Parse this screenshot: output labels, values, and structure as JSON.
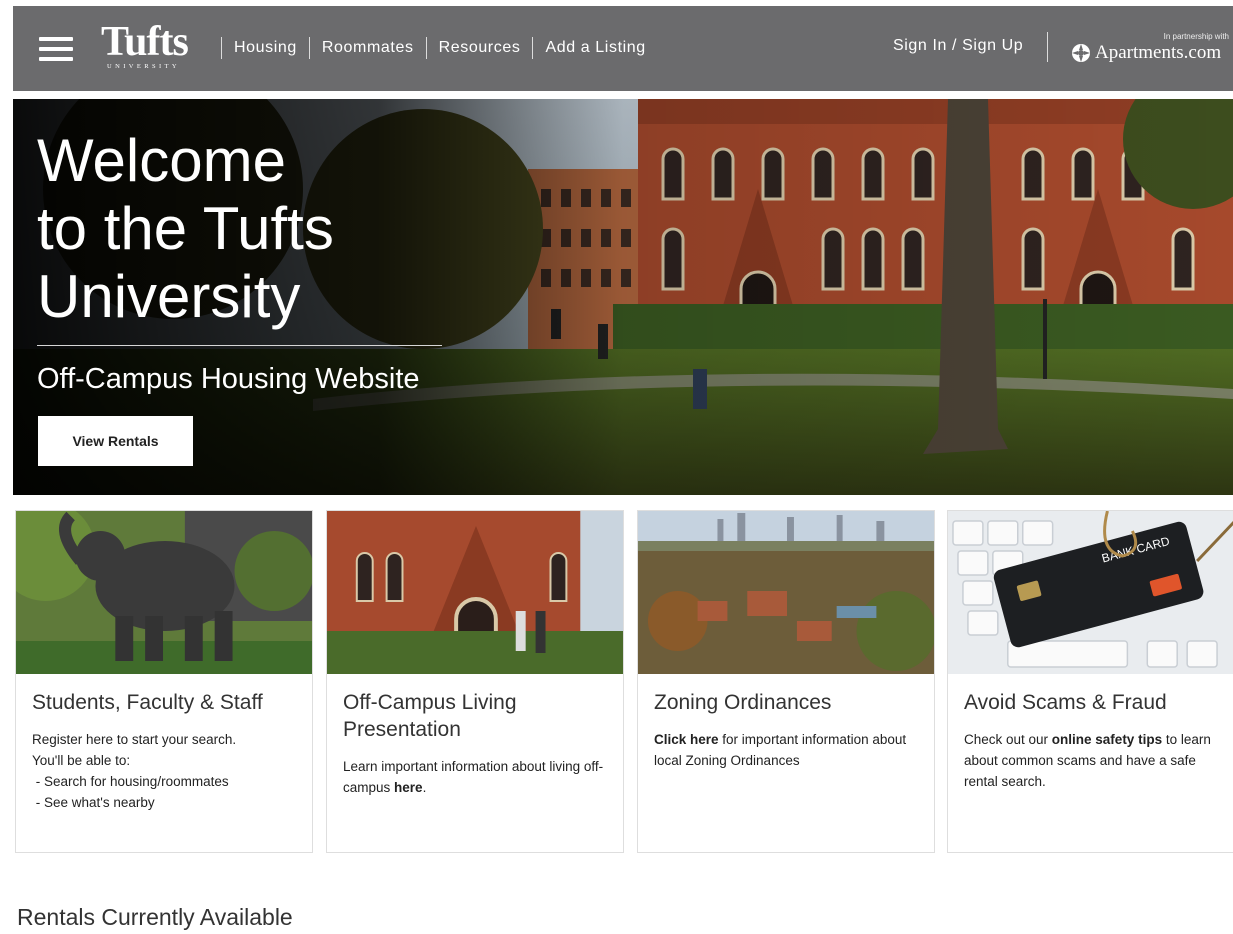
{
  "nav": {
    "logo_text": "Tufts",
    "logo_sub": "UNIVERSITY",
    "links": [
      "Housing",
      "Roommates",
      "Resources",
      "Add a Listing"
    ],
    "signin": "Sign In / Sign Up",
    "partner_note": "In partnership with",
    "partner_name": "Apartments.com"
  },
  "hero": {
    "title_line1": "Welcome",
    "title_line2": "to the Tufts",
    "title_line3": "University",
    "subtitle": "Off-Campus Housing Website",
    "button": "View Rentals"
  },
  "cards": [
    {
      "title": "Students, Faculty & Staff",
      "line1_pre": "Register ",
      "line1_link": "here",
      "line1_post": " to start your search.",
      "line2": "You'll be able to:",
      "line3": " - Search for housing/roommates",
      "line4": " - See what's nearby"
    },
    {
      "title": "Off-Campus Living Presentation",
      "text_pre": "Learn important information about living off-campus ",
      "text_link": "here",
      "text_post": "."
    },
    {
      "title": "Zoning Ordinances",
      "text_link": "Click here",
      "text_post": " for important information about local Zoning Ordinances"
    },
    {
      "title": "Avoid Scams & Fraud",
      "text_pre": "Check out our ",
      "text_link": "online safety tips",
      "text_post": " to learn about common scams and have a safe rental search.",
      "image_label": "BANK CARD"
    }
  ],
  "section_title": "Rentals Currently Available",
  "colors": {
    "nav_bg": "#6b6b6d",
    "hero_overlay": "#000000"
  }
}
